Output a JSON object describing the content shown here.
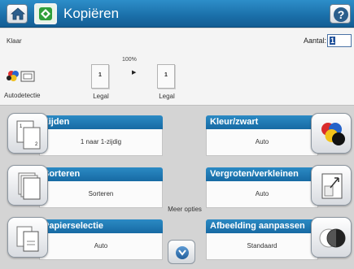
{
  "header": {
    "title": "Kopiëren",
    "home_icon": "home-icon",
    "app_icon": "copy-app-icon",
    "help_icon": "help-icon"
  },
  "status": {
    "text": "Klaar"
  },
  "copies": {
    "label": "Aantal:",
    "value": "1"
  },
  "preview": {
    "scale": "100%",
    "input_pages": "1",
    "output_pages": "1",
    "input_size": "Legal",
    "output_size": "Legal",
    "autodetect_label": "Autodetectie"
  },
  "tiles": {
    "zijden": {
      "title": "Zijden",
      "value": "1 naar 1-zijdig"
    },
    "sorteren": {
      "title": "Sorteren",
      "value": "Sorteren"
    },
    "papierselectie": {
      "title": "Papierselectie",
      "value": "Auto"
    },
    "kleur": {
      "title": "Kleur/zwart",
      "value": "Auto"
    },
    "vergroten": {
      "title": "Vergroten/verkleinen",
      "value": "Auto"
    },
    "afbeelding": {
      "title": "Afbeelding aanpassen",
      "value": "Standaard"
    }
  },
  "more": {
    "label": "Meer opties"
  },
  "colors": {
    "accent": "#1a6fa9",
    "tile_header": "#2b8ac4"
  }
}
